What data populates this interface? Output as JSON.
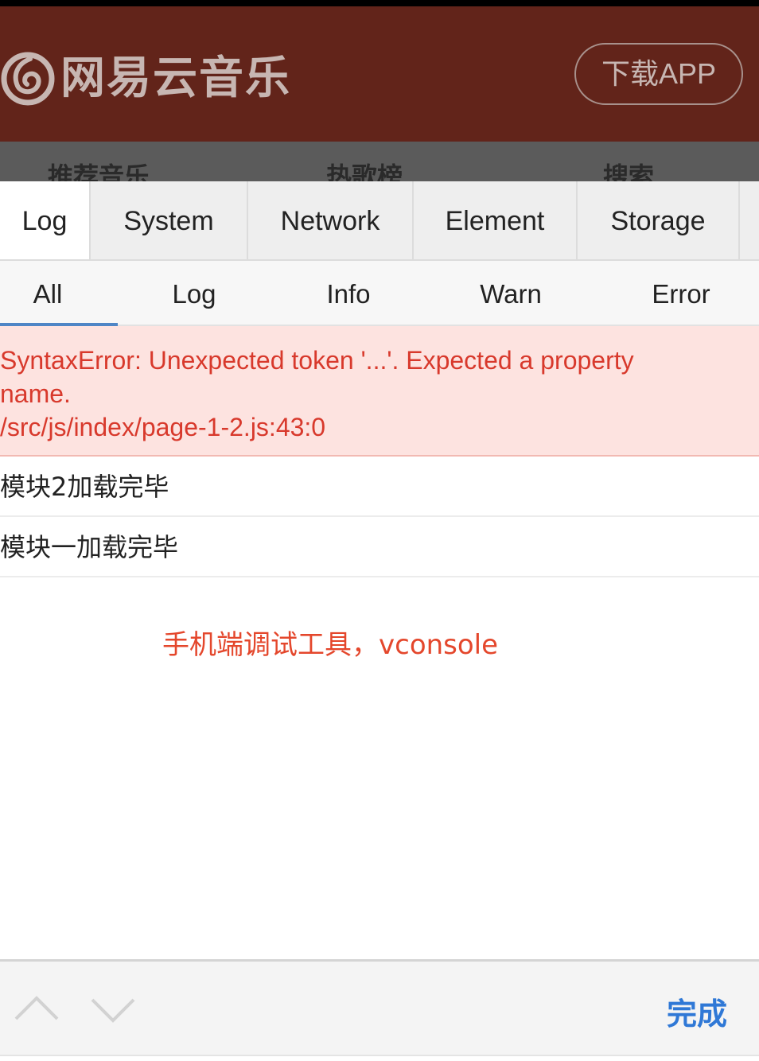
{
  "app": {
    "logo_text": "网易云音乐",
    "download_label": "下载APP",
    "nav": [
      "推荐音乐",
      "热歌榜",
      "搜索"
    ]
  },
  "vconsole": {
    "tabs": [
      "Log",
      "System",
      "Network",
      "Element",
      "Storage"
    ],
    "active_tab": "Log",
    "subtabs": [
      "All",
      "Log",
      "Info",
      "Warn",
      "Error"
    ],
    "active_subtab": "All",
    "logs": {
      "error_lines": [
        "SyntaxError: Unexpected token '...'. Expected a property",
        "name.",
        "/src/js/index/page-1-2.js:43:0"
      ],
      "items": [
        "模块2加载完毕",
        "模块一加载完毕"
      ]
    },
    "toolbar": {
      "prev_icon": "chevron-up-icon",
      "next_icon": "chevron-down-icon",
      "done_label": "完成"
    }
  },
  "annotation": "手机端调试工具，vconsole",
  "colors": {
    "header_bg": "#62241a",
    "error_bg": "#fde3e0",
    "error_text": "#d8392c",
    "annotation": "#e4472c",
    "done": "#2f78d6",
    "active_underline": "#4f86c6"
  }
}
